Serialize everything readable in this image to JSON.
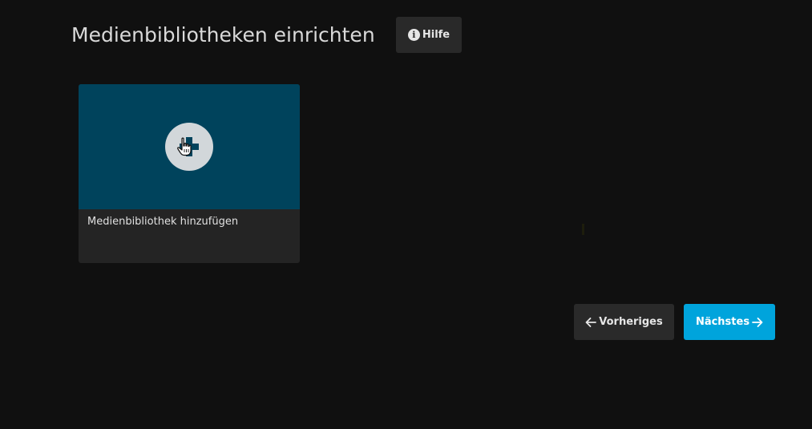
{
  "header": {
    "title": "Medienbibliotheken einrichten",
    "help_label": "Hilfe",
    "help_icon": "info-icon",
    "help_icon_glyph": "i"
  },
  "libraries": {
    "add_card": {
      "label": "Medienbibliothek hinzufügen",
      "icon": "plus-icon",
      "image_color": "#00435c"
    }
  },
  "navigation": {
    "previous_label": "Vorheriges",
    "previous_icon": "arrow-left-icon",
    "next_label": "Nächstes",
    "next_icon": "arrow-right-icon"
  },
  "colors": {
    "background": "#101010",
    "accent": "#00a4dc",
    "card_background": "#242424",
    "button_background": "#2a2a2a"
  }
}
